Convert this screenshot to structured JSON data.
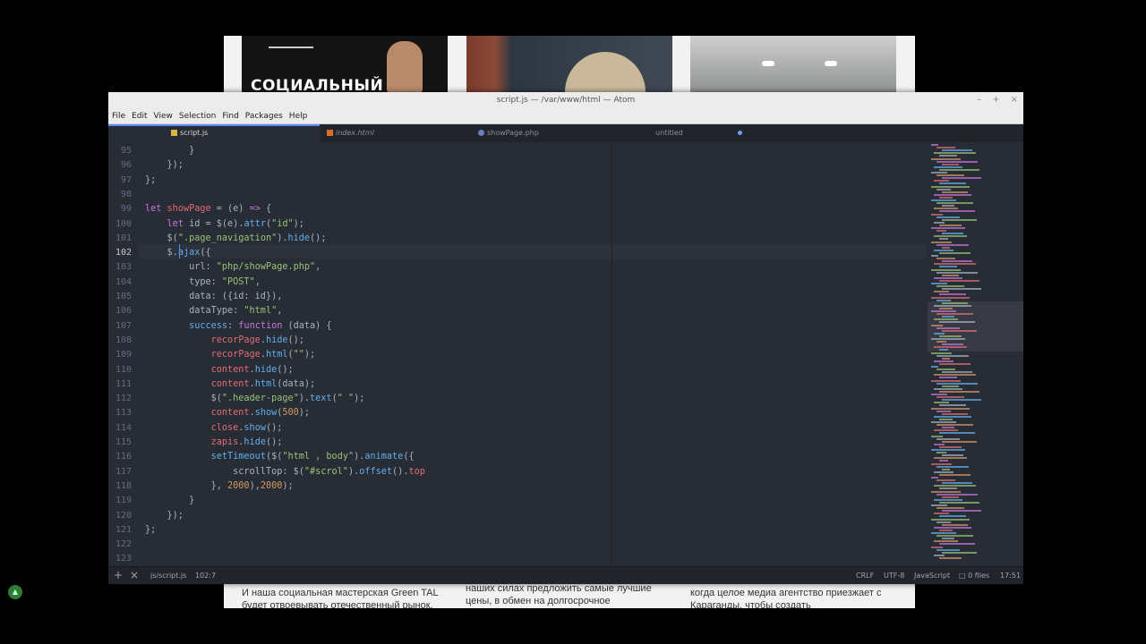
{
  "background_page": {
    "banner_title": "СОЦИАЛЬНЫЙ",
    "texts": [
      "И наша социальная мастерская Green TAL будет отвоевывать отечественный рынок,",
      "наших силах предложить самые лучшие цены, в обмен на долгосрочное",
      "когда целое медиа агентство приезжает с Караганды, чтобы создать короткометражный"
    ],
    "scroll_top_icon": "chevron-up-icon"
  },
  "window": {
    "title": "script.js — /var/www/html — Atom",
    "controls": {
      "minimize": "–",
      "maximize": "+",
      "close": "×"
    }
  },
  "menu": [
    "File",
    "Edit",
    "View",
    "Selection",
    "Find",
    "Packages",
    "Help"
  ],
  "tabs": [
    {
      "label": "script.js",
      "icon": "js-file-icon",
      "active": true
    },
    {
      "label": "index.html",
      "icon": "html-file-icon",
      "active": false
    },
    {
      "label": "showPage.php",
      "icon": "php-file-icon",
      "active": false
    },
    {
      "label": "untitled",
      "icon": "",
      "active": false,
      "modified": true
    }
  ],
  "editor": {
    "line_numbers": [
      "95",
      "96",
      "97",
      "98",
      "99",
      "100",
      "101",
      "102",
      "103",
      "104",
      "105",
      "106",
      "107",
      "108",
      "109",
      "110",
      "111",
      "112",
      "113",
      "114",
      "115",
      "116",
      "117",
      "118",
      "119",
      "120",
      "121",
      "122",
      "123"
    ],
    "lines": [
      [
        [
          "p",
          "        }"
        ]
      ],
      [
        [
          "p",
          "    });"
        ]
      ],
      [
        [
          "p",
          "};"
        ]
      ],
      [
        [
          "p",
          ""
        ]
      ],
      [
        [
          "k",
          "let "
        ],
        [
          "v",
          "showPage"
        ],
        [
          "p",
          " = (e) "
        ],
        [
          "k",
          "=>"
        ],
        [
          "p",
          " {"
        ]
      ],
      [
        [
          "p",
          "    "
        ],
        [
          "k",
          "let "
        ],
        [
          "p",
          "id = $(e)."
        ],
        [
          "f",
          "attr"
        ],
        [
          "p",
          "("
        ],
        [
          "s",
          "\"id\""
        ],
        [
          "p",
          ");"
        ]
      ],
      [
        [
          "p",
          "    $("
        ],
        [
          "s",
          "\".page_navigation\""
        ],
        [
          "p",
          ")."
        ],
        [
          "f",
          "hide"
        ],
        [
          "p",
          "();"
        ]
      ],
      [
        [
          "p",
          "    $."
        ],
        [
          "f",
          "ajax"
        ],
        [
          "p",
          "({"
        ]
      ],
      [
        [
          "p",
          "        url: "
        ],
        [
          "s",
          "\"php/showPage.php\""
        ],
        [
          "p",
          ","
        ]
      ],
      [
        [
          "p",
          "        type: "
        ],
        [
          "s",
          "\"POST\""
        ],
        [
          "p",
          ","
        ]
      ],
      [
        [
          "p",
          "        data: ({id: id}),"
        ]
      ],
      [
        [
          "p",
          "        dataType: "
        ],
        [
          "s",
          "\"html\""
        ],
        [
          "p",
          ","
        ]
      ],
      [
        [
          "p",
          "        "
        ],
        [
          "f",
          "success"
        ],
        [
          "p",
          ": "
        ],
        [
          "k",
          "function "
        ],
        [
          "p",
          "(data) {"
        ]
      ],
      [
        [
          "p",
          "            "
        ],
        [
          "v",
          "recorPage"
        ],
        [
          "p",
          "."
        ],
        [
          "f",
          "hide"
        ],
        [
          "p",
          "();"
        ]
      ],
      [
        [
          "p",
          "            "
        ],
        [
          "v",
          "recorPage"
        ],
        [
          "p",
          "."
        ],
        [
          "f",
          "html"
        ],
        [
          "p",
          "("
        ],
        [
          "s",
          "\"\""
        ],
        [
          "p",
          ");"
        ]
      ],
      [
        [
          "p",
          "            "
        ],
        [
          "v",
          "content"
        ],
        [
          "p",
          "."
        ],
        [
          "f",
          "hide"
        ],
        [
          "p",
          "();"
        ]
      ],
      [
        [
          "p",
          "            "
        ],
        [
          "v",
          "content"
        ],
        [
          "p",
          "."
        ],
        [
          "f",
          "html"
        ],
        [
          "p",
          "(data);"
        ]
      ],
      [
        [
          "p",
          "            $("
        ],
        [
          "s",
          "\".header-page\""
        ],
        [
          "p",
          ")."
        ],
        [
          "f",
          "text"
        ],
        [
          "p",
          "("
        ],
        [
          "s",
          "\" \""
        ],
        [
          "p",
          ");"
        ]
      ],
      [
        [
          "p",
          "            "
        ],
        [
          "v",
          "content"
        ],
        [
          "p",
          "."
        ],
        [
          "f",
          "show"
        ],
        [
          "p",
          "("
        ],
        [
          "n",
          "500"
        ],
        [
          "p",
          ");"
        ]
      ],
      [
        [
          "p",
          "            "
        ],
        [
          "v",
          "close"
        ],
        [
          "p",
          "."
        ],
        [
          "f",
          "show"
        ],
        [
          "p",
          "();"
        ]
      ],
      [
        [
          "p",
          "            "
        ],
        [
          "v",
          "zapis"
        ],
        [
          "p",
          "."
        ],
        [
          "f",
          "hide"
        ],
        [
          "p",
          "();"
        ]
      ],
      [
        [
          "p",
          "            "
        ],
        [
          "f",
          "setTimeout"
        ],
        [
          "p",
          "($("
        ],
        [
          "s",
          "\"html , body\""
        ],
        [
          "p",
          ")."
        ],
        [
          "f",
          "animate"
        ],
        [
          "p",
          "({"
        ]
      ],
      [
        [
          "p",
          "                scrollTop: $("
        ],
        [
          "s",
          "\"#scrol\""
        ],
        [
          "p",
          ")."
        ],
        [
          "f",
          "offset"
        ],
        [
          "p",
          "()."
        ],
        [
          "v",
          "top"
        ]
      ],
      [
        [
          "p",
          "            }, "
        ],
        [
          "n",
          "2000"
        ],
        [
          "p",
          "),"
        ],
        [
          "n",
          "2000"
        ],
        [
          "p",
          ");"
        ]
      ],
      [
        [
          "p",
          "        }"
        ]
      ],
      [
        [
          "p",
          "    });"
        ]
      ],
      [
        [
          "p",
          "};"
        ]
      ],
      [
        [
          "p",
          ""
        ]
      ],
      [
        [
          "p",
          ""
        ]
      ]
    ]
  },
  "status": {
    "add_icon": "+",
    "close_icon": "×",
    "file_path": "js/script.js",
    "cursor_position": "102:7",
    "line_ending": "CRLF",
    "encoding": "UTF-8",
    "grammar": "JavaScript",
    "git_files": "0 files",
    "time": "17:51"
  }
}
